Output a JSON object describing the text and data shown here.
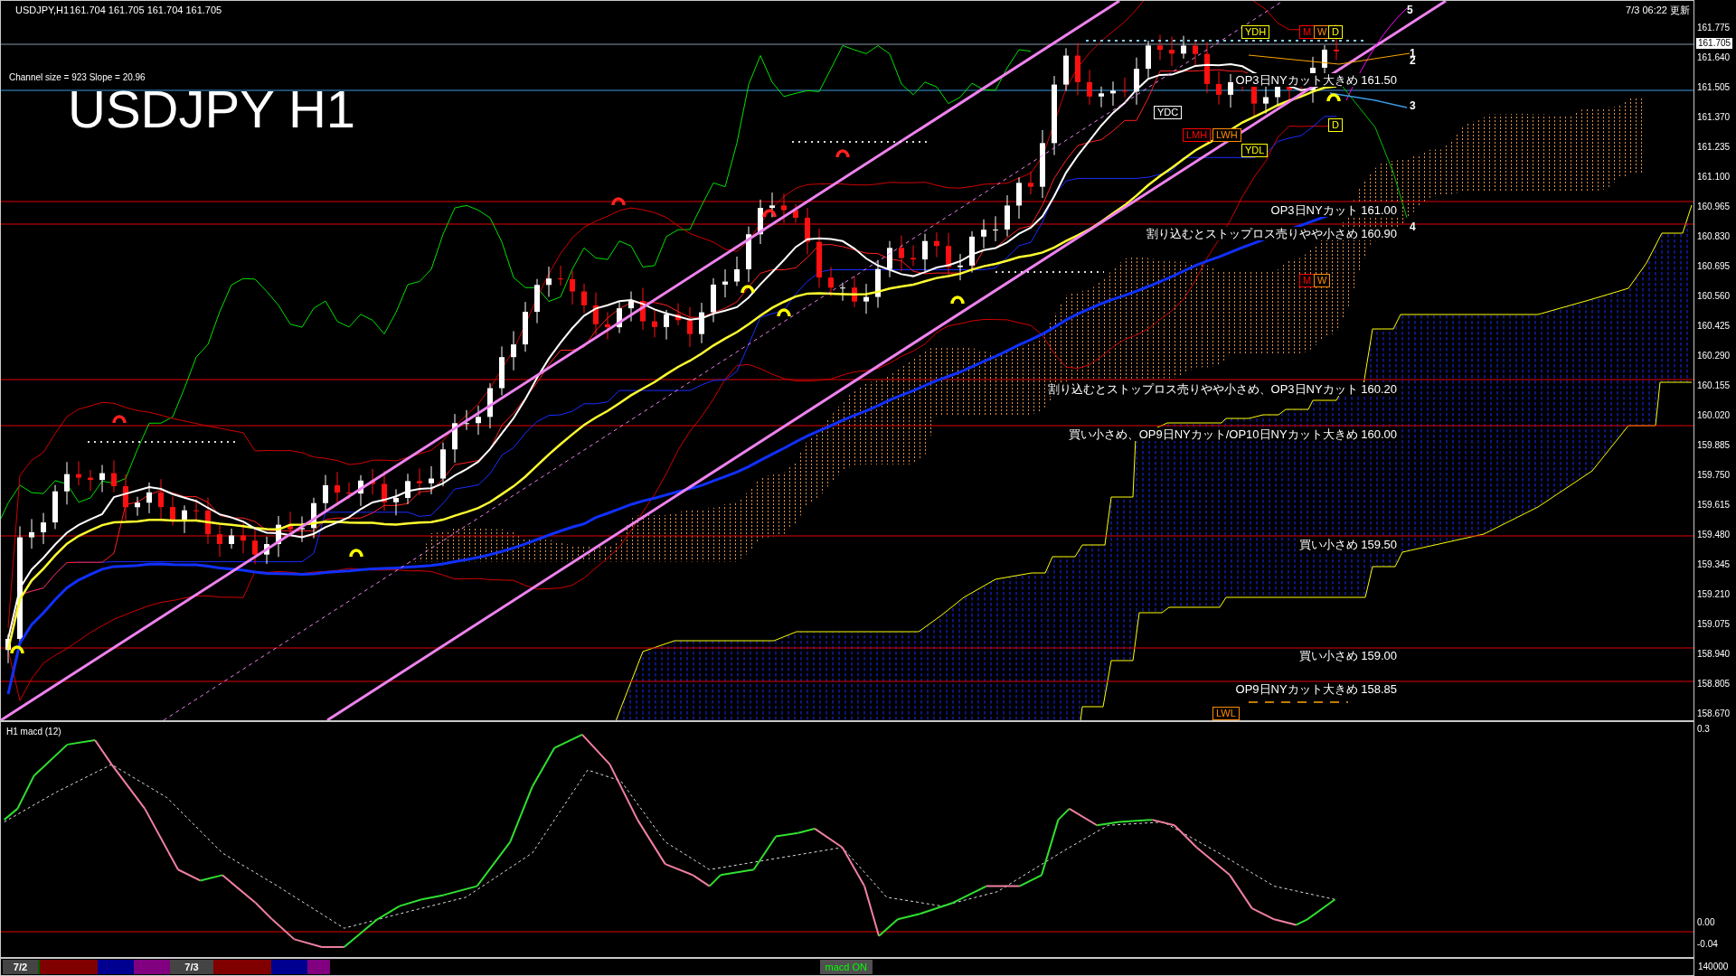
{
  "header": {
    "symbol": "USDJPY,H1",
    "prices": "161.704 161.705 161.704 161.705",
    "updated": "7/3 06:22 更新"
  },
  "title": "USDJPY H1",
  "channel_info": "Channel size = 923 Slope = 20.96",
  "levels": [
    {
      "text": "OP3日NYカット大きめ 161.50"
    },
    {
      "text": "OP3日NYカット 161.00"
    },
    {
      "text": "割り込むとストップロス売りやや小さめ 160.90"
    },
    {
      "text": "割り込むとストップロス売りやや小さめ、OP3日NYカット 160.20"
    },
    {
      "text": "買い小さめ、OP9日NYカット/OP10日NYカット大きめ 160.00"
    },
    {
      "text": "買い小さめ 159.50"
    },
    {
      "text": "買い小さめ 159.00"
    },
    {
      "text": "OP9日NYカット大きめ 158.85"
    }
  ],
  "markers": [
    {
      "text": "YDH",
      "color": "#ffff00"
    },
    {
      "text": "M",
      "color": "#ff0000"
    },
    {
      "text": "W",
      "color": "#ff8c00"
    },
    {
      "text": "D",
      "color": "#ffff00"
    },
    {
      "text": "YDC",
      "color": "#ffffff"
    },
    {
      "text": "LMH",
      "color": "#ff0000"
    },
    {
      "text": "LWH",
      "color": "#ff8c00"
    },
    {
      "text": "D",
      "color": "#ffff00"
    },
    {
      "text": "YDL",
      "color": "#ffff00"
    },
    {
      "text": "M",
      "color": "#ff0000"
    },
    {
      "text": "W",
      "color": "#ff8c00"
    },
    {
      "text": "LWL",
      "color": "#ff8c00"
    }
  ],
  "channel_labels": [
    "5",
    "1",
    "2",
    "3",
    "4"
  ],
  "price_axis": {
    "labels": [
      "161.775",
      "161.640",
      "161.505",
      "161.370",
      "161.235",
      "161.100",
      "160.965",
      "160.830",
      "160.695",
      "160.560",
      "160.425",
      "160.290",
      "160.155",
      "160.020",
      "159.885",
      "159.750",
      "159.615",
      "159.480",
      "159.345",
      "159.210",
      "159.075",
      "158.940",
      "158.805",
      "158.670"
    ],
    "current": "161.705"
  },
  "macd": {
    "label": "H1  macd (12)",
    "axis": [
      "0.3",
      "0.00",
      "-0.04"
    ]
  },
  "timeline": {
    "dates": [
      "7/2",
      "7/3"
    ],
    "toggle": "macd ON",
    "volume_label": "140000"
  }
}
